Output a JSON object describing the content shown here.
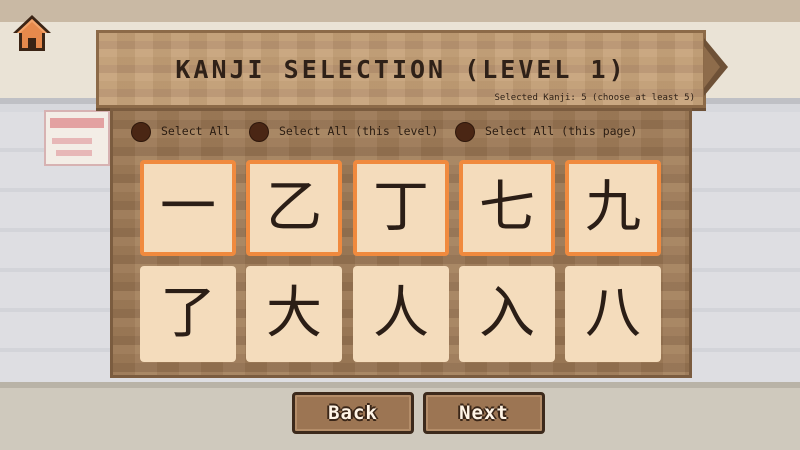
{
  "header": {
    "title": "KANJI SELECTION (LEVEL 1)",
    "subtitle": "Selected Kanji: 5 (choose at least 5)",
    "home_icon": "home-icon",
    "next_page_icon": "arrow-right-icon"
  },
  "filters": [
    {
      "label": "Select All",
      "checked": false
    },
    {
      "label": "Select All (this level)",
      "checked": false
    },
    {
      "label": "Select All (this page)",
      "checked": false
    }
  ],
  "kanji": [
    {
      "char": "一",
      "selected": true
    },
    {
      "char": "乙",
      "selected": true
    },
    {
      "char": "丁",
      "selected": true
    },
    {
      "char": "七",
      "selected": true
    },
    {
      "char": "九",
      "selected": true
    },
    {
      "char": "了",
      "selected": false
    },
    {
      "char": "大",
      "selected": false
    },
    {
      "char": "人",
      "selected": false
    },
    {
      "char": "入",
      "selected": false
    },
    {
      "char": "八",
      "selected": false
    }
  ],
  "nav": {
    "back_label": "Back",
    "next_label": "Next"
  },
  "colors": {
    "selected_border": "#f08a3e",
    "tile_bg": "#f4dcbc",
    "wood": "#9d7a57",
    "radio": "#4a2614"
  }
}
